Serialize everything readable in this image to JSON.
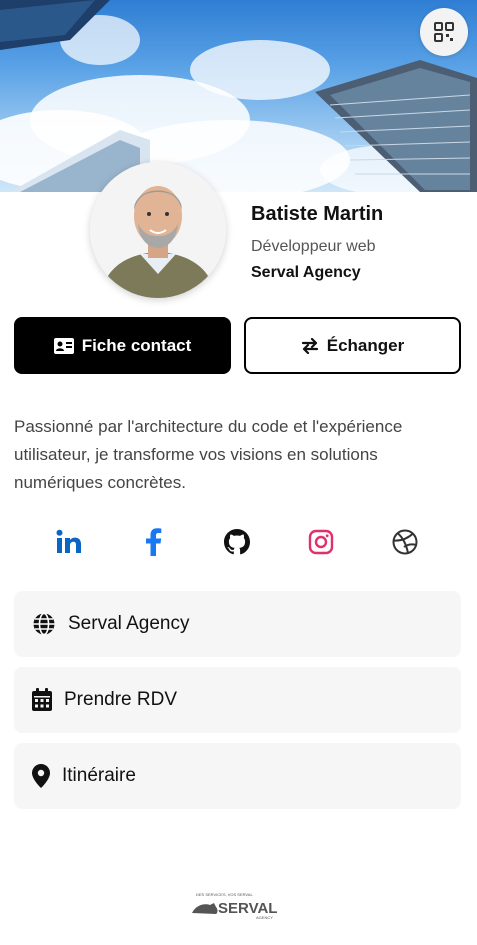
{
  "profile": {
    "name": "Batiste Martin",
    "role": "Développeur web",
    "company": "Serval Agency",
    "bio": "Passionné par l'architecture du code et l'expérience utilisateur, je transforme vos visions en solutions numériques concrètes."
  },
  "actions": {
    "contact_label": "Fiche contact",
    "exchange_label": "Échanger"
  },
  "socials": [
    {
      "name": "linkedin-icon",
      "color": "#0a66c2"
    },
    {
      "name": "facebook-icon",
      "color": "#1877f2"
    },
    {
      "name": "github-icon",
      "color": "#111111"
    },
    {
      "name": "instagram-icon",
      "color": "#e1306c"
    },
    {
      "name": "dribbble-icon",
      "color": "#333333"
    }
  ],
  "links": [
    {
      "label": "Serval Agency",
      "icon": "globe-icon"
    },
    {
      "label": "Prendre RDV",
      "icon": "calendar-icon"
    },
    {
      "label": "Itinéraire",
      "icon": "map-pin-icon"
    }
  ],
  "footer": {
    "logo_text": "SERVAL",
    "logo_subtext": "AGENCY",
    "logo_tagline": "DES SERVICES, VOS SERVAL"
  },
  "colors": {
    "primary_button": "#000000",
    "card_bg": "#f6f6f6",
    "accent_logo": "#e8a21a"
  }
}
